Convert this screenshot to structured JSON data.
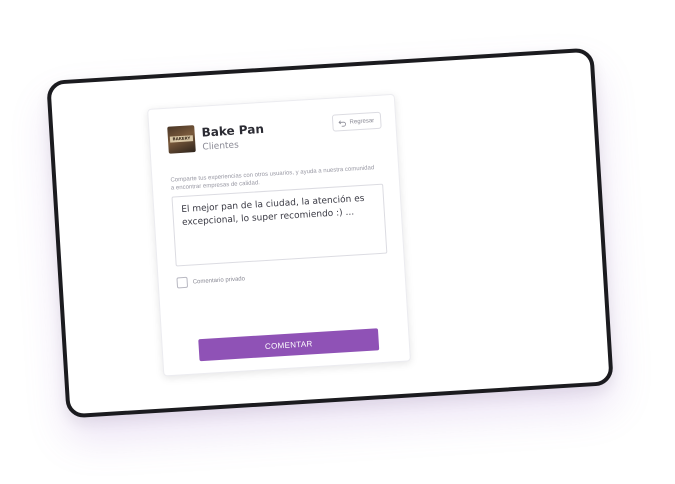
{
  "business": {
    "name": "Bake Pan",
    "category": "Clientes",
    "logo_text": "BAKERY"
  },
  "header": {
    "back_label": "Regresar"
  },
  "review": {
    "prompt": "Comparte tus experiencias con otros usuarios, y ayuda a nuestra comunidad a encontrar empresas de calidad.",
    "text": "El mejor pan de la ciudad, la atención es excepcional, lo super recomiendo :) ...",
    "private_label": "Comentario privado",
    "private_checked": false
  },
  "actions": {
    "submit_label": "COMENTAR"
  },
  "colors": {
    "accent": "#8f52b6",
    "device_frame": "#1b1b1f"
  }
}
